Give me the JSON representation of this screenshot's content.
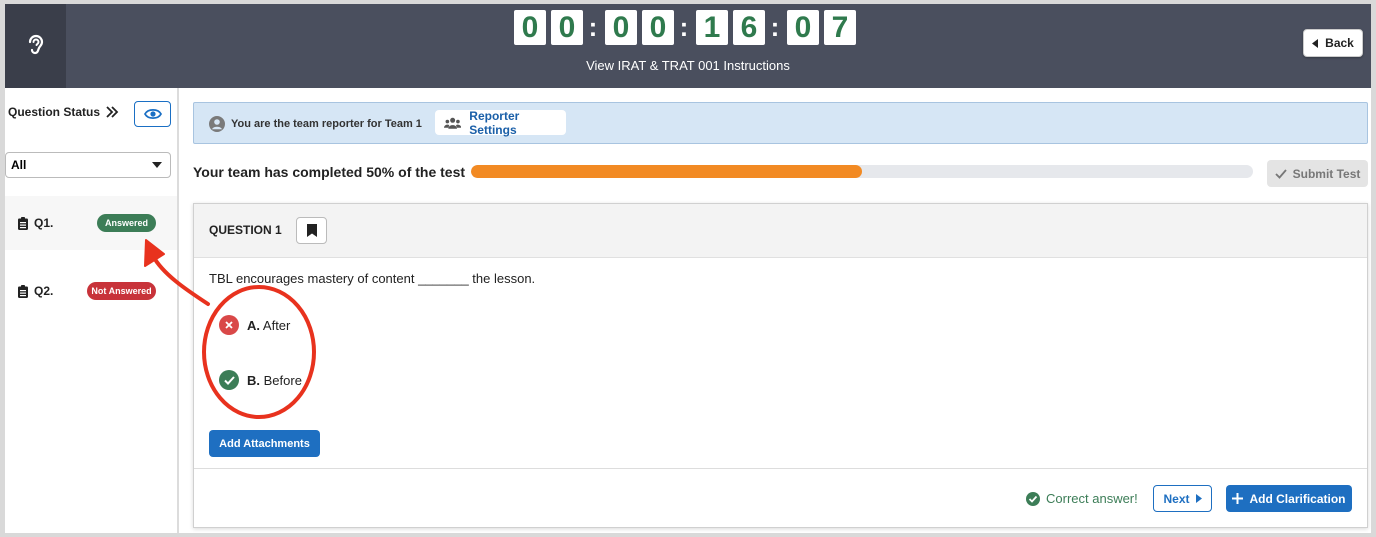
{
  "header": {
    "timer_digits": [
      "0",
      "0",
      "0",
      "0",
      "1",
      "6",
      "0",
      "7"
    ],
    "timer_separator": ":",
    "instructions": "View IRAT & TRAT 001 Instructions",
    "back_label": "Back"
  },
  "sidebar": {
    "title": "Question Status",
    "filter_value": "All",
    "questions": [
      {
        "label": "Q1.",
        "status": "Answered",
        "status_color": "#3c7d57"
      },
      {
        "label": "Q2.",
        "status": "Not Answered",
        "status_color": "#c8333a"
      }
    ]
  },
  "banner": {
    "text": "You are the team reporter for Team 1",
    "reporter_settings": "Reporter Settings"
  },
  "progress": {
    "text": "Your team has completed 50% of the test",
    "percent": 50,
    "fill_color": "#f28a23",
    "submit_label": "Submit Test"
  },
  "question": {
    "title": "QUESTION 1",
    "text": "TBL encourages mastery of content _______ the lesson.",
    "options": [
      {
        "letter": "A.",
        "text": "After",
        "state": "wrong"
      },
      {
        "letter": "B.",
        "text": "Before",
        "state": "correct"
      }
    ],
    "attach_label": "Add Attachments",
    "feedback": "Correct answer!",
    "next_label": "Next",
    "clarification_label": "Add Clarification"
  },
  "colors": {
    "header_bg": "#4a4f5e",
    "accent": "#1e6fc1",
    "annotation": "#e8321e"
  }
}
